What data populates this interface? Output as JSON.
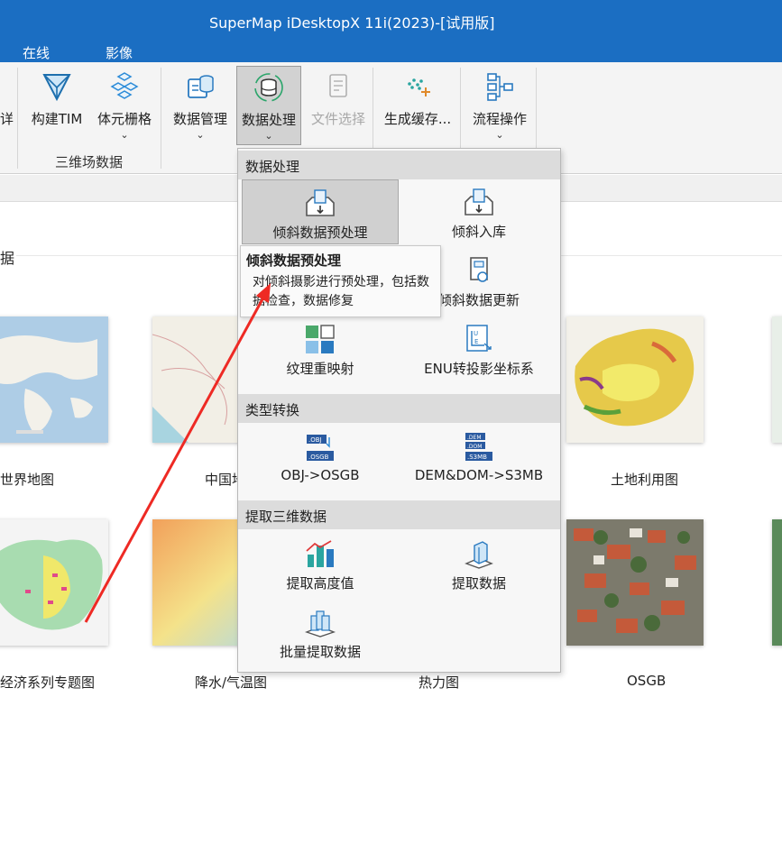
{
  "window": {
    "title": "SuperMap iDesktopX 11i(2023)-[试用版]"
  },
  "menubar": {
    "items": [
      "在线",
      "影像"
    ]
  },
  "ribbon": {
    "partial_label": "详",
    "buttons": {
      "build_tim": "构建TIM",
      "voxel_grid": "体元栅格",
      "data_manage": "数据管理",
      "data_process": "数据处理",
      "file_select": "文件选择",
      "gen_cache": "生成缓存...",
      "flow_ops": "流程操作"
    },
    "group_label": "三维场数据",
    "chevron": "⌄"
  },
  "dropdown": {
    "sections": {
      "process": "数据处理",
      "convert": "类型转换",
      "extract": "提取三维数据"
    },
    "items": {
      "oblique_preprocess": "倾斜数据预处理",
      "oblique_import": "倾斜入库",
      "oblique_update": "倾斜数据更新",
      "texture_remap": "纹理重映射",
      "enu_transform": "ENU转投影坐标系",
      "obj_osgb": "OBJ->OSGB",
      "dem_dom_s3mb": "DEM&DOM->S3MB",
      "extract_height": "提取高度值",
      "extract_data": "提取数据",
      "batch_extract": "批量提取数据"
    },
    "icon_text": {
      "obj": ".OBJ",
      "osgb": ".OSGB",
      "dem": ".DEM",
      "dom": ".DOM",
      "s3mb": ".S3MB"
    }
  },
  "tooltip": {
    "title": "倾斜数据预处理",
    "description": "对倾斜摄影进行预处理，包括数据检查，数据修复"
  },
  "content": {
    "section_heading": "据",
    "thumbnails": {
      "world_map": "世界地图",
      "china_map": "中国地图",
      "land_use": "土地利用图",
      "economy": "经济系列专题图",
      "precip_temp": "降水/气温图",
      "heat_map": "热力图",
      "osgb": "OSGB"
    }
  },
  "colors": {
    "titlebar": "#1b6ec2",
    "accent": "#2a8ad8",
    "arrow": "#ee2a24"
  }
}
